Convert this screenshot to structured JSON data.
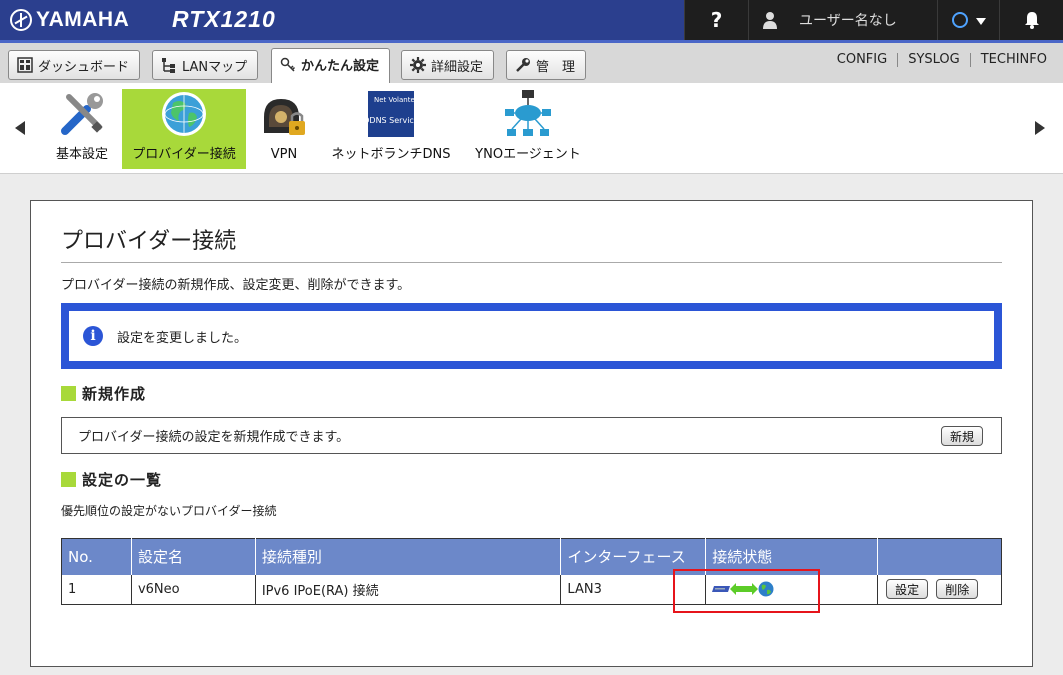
{
  "header": {
    "brand": "YAMAHA",
    "model": "RTX1210",
    "help_label": "?",
    "user_label": "ユーザー名なし"
  },
  "tabs": [
    {
      "label": "ダッシュボード",
      "icon": "dashboard-icon"
    },
    {
      "label": "LANマップ",
      "icon": "lan-map-icon"
    },
    {
      "label": "かんたん設定",
      "icon": "easy-setup-icon",
      "active": true
    },
    {
      "label": "詳細設定",
      "icon": "gear-icon"
    },
    {
      "label": "管　理",
      "icon": "wrench-icon"
    }
  ],
  "toplinks": [
    "CONFIG",
    "SYSLOG",
    "TECHINFO"
  ],
  "nav": {
    "items": [
      {
        "label": "基本設定",
        "icon": "tools-icon"
      },
      {
        "label": "プロバイダー接続",
        "icon": "globe-icon",
        "active": true
      },
      {
        "label": "VPN",
        "icon": "vpn-lock-icon"
      },
      {
        "label": "ネットボランチDNS",
        "icon": "ddns-service-icon",
        "badge_top": "Net Volante",
        "badge_bottom": "DDNS Service"
      },
      {
        "label": "YNOエージェント",
        "icon": "yno-network-icon"
      }
    ]
  },
  "page": {
    "title": "プロバイダー接続",
    "description": "プロバイダー接続の新規作成、設定変更、削除ができます。",
    "notice": "設定を変更しました。",
    "new_section": {
      "heading": "新規作成",
      "text": "プロバイダー接続の設定を新規作成できます。",
      "button": "新規"
    },
    "list_section": {
      "heading": "設定の一覧",
      "note": "優先順位の設定がないプロバイダー接続",
      "columns": [
        "No.",
        "設定名",
        "接続種別",
        "インターフェース",
        "接続状態",
        ""
      ],
      "rows": [
        {
          "no": "1",
          "name": "v6Neo",
          "type": "IPv6 IPoE(RA) 接続",
          "interface": "LAN3",
          "status": "connected"
        }
      ],
      "edit_button": "設定",
      "delete_button": "削除"
    }
  },
  "colors": {
    "header_blue": "#2b3f8e",
    "active_green": "#a8d93a",
    "notice_blue": "#2b55d6",
    "table_header": "#6c88c9",
    "highlight_red": "#e6141b"
  }
}
